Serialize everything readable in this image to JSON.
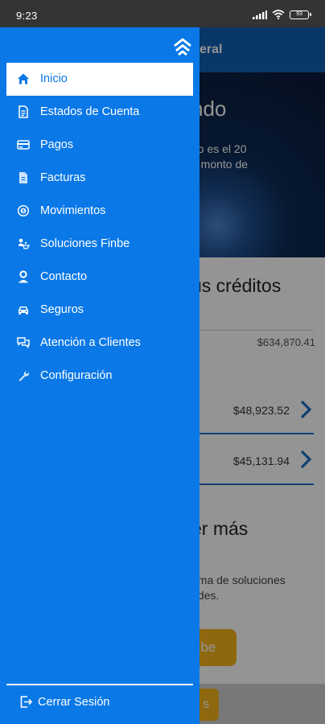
{
  "status_bar": {
    "time": "9:23",
    "battery": "93"
  },
  "background": {
    "appbar_title": "eral",
    "hero_title": "ndo",
    "hero_text": "go es el 20\nn monto de",
    "section_title": "us créditos",
    "total": "$634,870.41",
    "rows": [
      {
        "amount": "$48,923.52"
      },
      {
        "amount": "$45,131.94"
      }
    ],
    "section2_title": "er más",
    "section2_text": "ama de soluciones\nades.",
    "yellow_button": "nbe",
    "bottom_button": "s"
  },
  "drawer": {
    "items": [
      {
        "label": "Inicio",
        "icon": "home-icon"
      },
      {
        "label": "Estados de Cuenta",
        "icon": "document-icon"
      },
      {
        "label": "Pagos",
        "icon": "credit-card-icon"
      },
      {
        "label": "Facturas",
        "icon": "invoice-icon"
      },
      {
        "label": "Movimientos",
        "icon": "movements-icon"
      },
      {
        "label": "Soluciones Finbe",
        "icon": "solutions-icon"
      },
      {
        "label": "Contacto",
        "icon": "person-icon"
      },
      {
        "label": "Seguros",
        "icon": "car-icon"
      },
      {
        "label": "Atención a Clientes",
        "icon": "chat-icon"
      },
      {
        "label": "Configuración",
        "icon": "wrench-icon"
      }
    ],
    "logout_label": "Cerrar Sesión"
  },
  "colors": {
    "drawer_blue": "#0a78e6",
    "accent_yellow": "#f4b41a",
    "appbar_blue": "#0e5fb3"
  }
}
